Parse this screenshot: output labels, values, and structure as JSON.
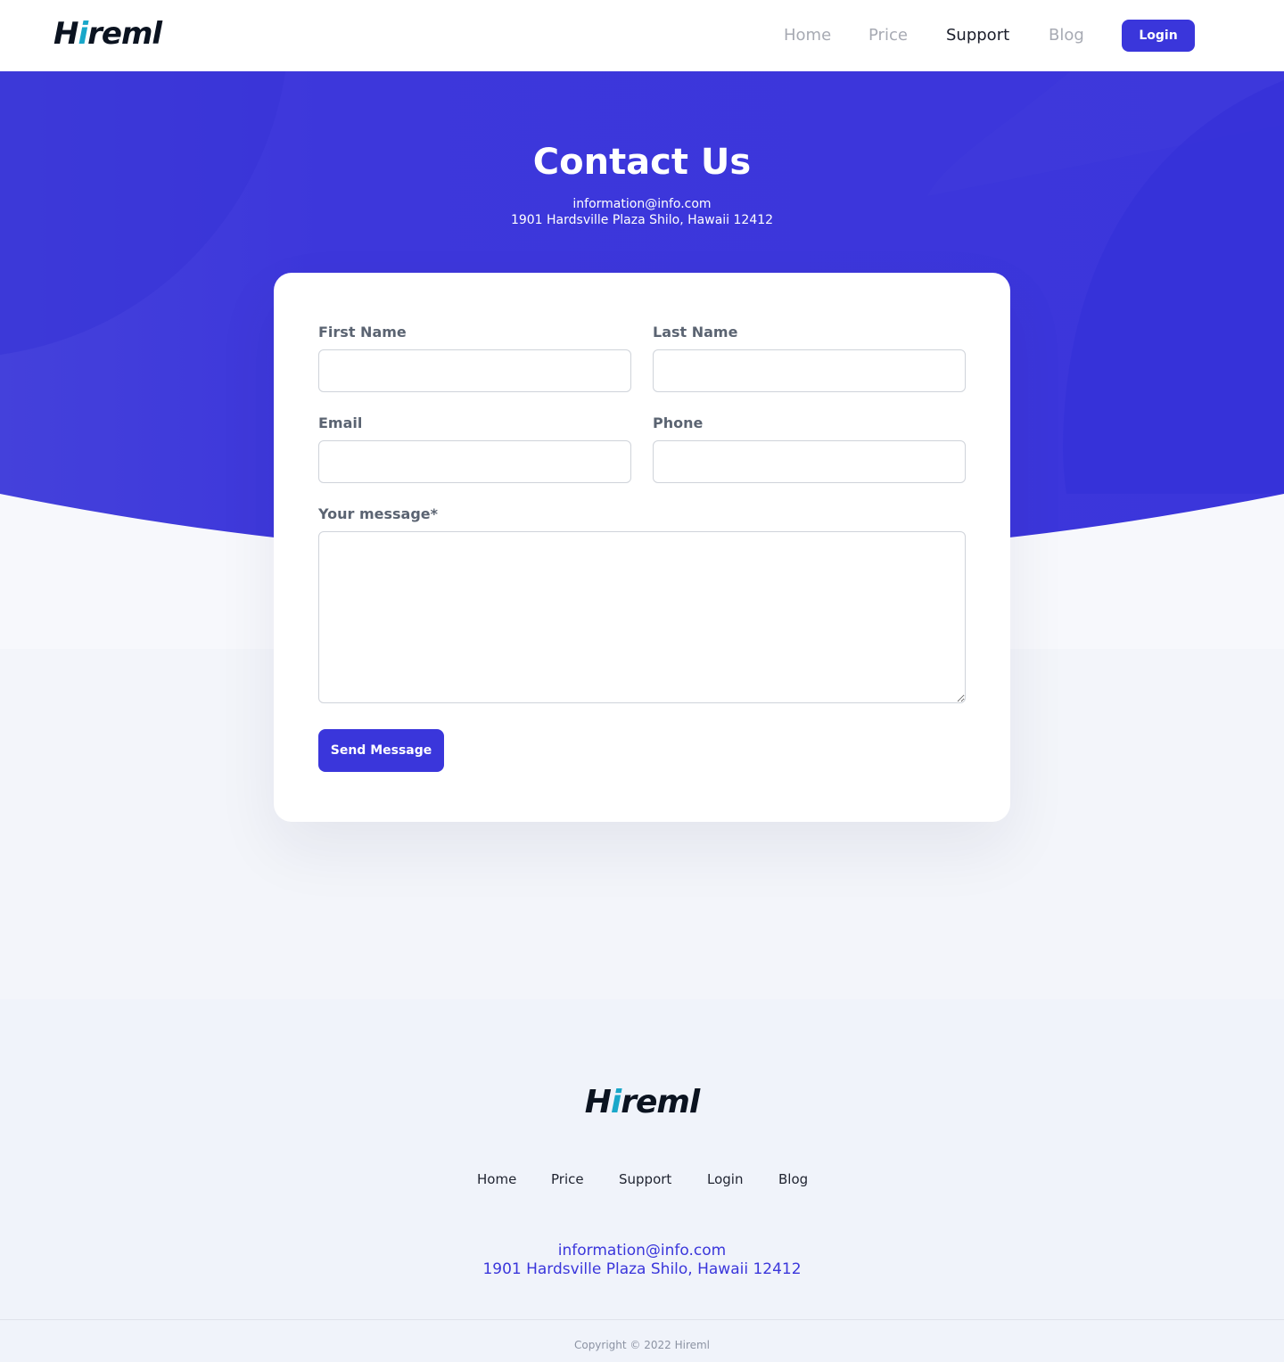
{
  "brand": {
    "name_prefix": "H",
    "name_i": "i",
    "name_suffix": "reml",
    "color_primary": "#3a36db",
    "color_logo_accent": "#19a7c9"
  },
  "nav": {
    "items": [
      {
        "label": "Home",
        "active": false
      },
      {
        "label": "Price",
        "active": false
      },
      {
        "label": "Support",
        "active": true
      },
      {
        "label": "Blog",
        "active": false
      }
    ],
    "login_label": "Login"
  },
  "hero": {
    "title": "Contact Us",
    "email": "information@info.com",
    "address": "1901 Hardsville Plaza Shilo, Hawaii 12412"
  },
  "form": {
    "first_name": {
      "label": "First Name",
      "value": ""
    },
    "last_name": {
      "label": "Last Name",
      "value": ""
    },
    "email": {
      "label": "Email",
      "value": ""
    },
    "phone": {
      "label": "Phone",
      "value": ""
    },
    "message": {
      "label": "Your message*",
      "value": ""
    },
    "submit_label": "Send Message"
  },
  "footer": {
    "links": [
      "Home",
      "Price",
      "Support",
      "Login",
      "Blog"
    ],
    "email": "information@info.com",
    "address": "1901 Hardsville Plaza Shilo, Hawaii 12412",
    "copyright": "Copyright © 2022 Hireml"
  }
}
